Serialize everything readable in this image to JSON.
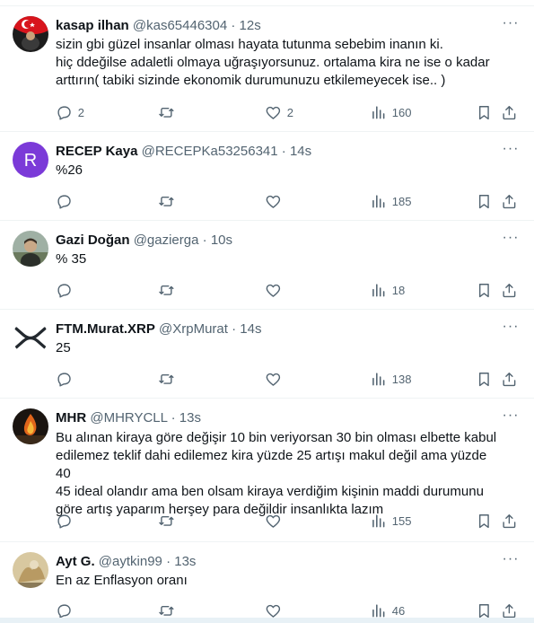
{
  "tweets": [
    {
      "name": "kasap ilhan",
      "handle": "@kas65446304",
      "time": "12s",
      "text": "sizin gbi güzel insanlar olması hayata tutunma sebebim inanın ki.\nhiç ddeğilse adaletli olmaya uğraşıyorsunuz. ortalama kira ne ise o kadar\narttırın( tabiki sizinde ekonomik durumunuzu etkilemeyecek ise.. )",
      "replies": "2",
      "retweets": "",
      "likes": "2",
      "views": "160",
      "avatar": "flag-avatar"
    },
    {
      "name": "RECEP Kaya",
      "handle": "@RECEPKa53256341",
      "time": "14s",
      "text": "%26",
      "replies": "",
      "retweets": "",
      "likes": "",
      "views": "185",
      "avatar": "letter-avatar",
      "avatar_letter": "R",
      "avatar_color": "#7b3ad8"
    },
    {
      "name": "Gazi Doğan",
      "handle": "@gazierga",
      "time": "10s",
      "text": "% 35",
      "replies": "",
      "retweets": "",
      "likes": "",
      "views": "18",
      "avatar": "photo-avatar"
    },
    {
      "name": "FTM.Murat.XRP",
      "handle": "@XrpMurat",
      "time": "14s",
      "text": "25",
      "replies": "",
      "retweets": "",
      "likes": "",
      "views": "138",
      "avatar": "xrp-logo-avatar"
    },
    {
      "name": "MHR",
      "handle": "@MHRYCLL",
      "time": "13s",
      "text": "Bu alınan kiraya göre değişir 10 bin veriyorsan 30 bin olması elbette kabul\nedilemez teklif dahi edilemez kira yüzde 25 artışı makul değil ama yüzde 40\n45 ideal olandır  ama ben olsam kiraya verdiğim kişinin maddi durumunu\ngöre artış yaparım herşey para değildir insanlıkta lazım",
      "replies": "",
      "retweets": "",
      "likes": "",
      "views": "155",
      "avatar": "fire-avatar"
    },
    {
      "name": "Ayt G.",
      "handle": "@aytkin99",
      "time": "13s",
      "text": "En az Enflasyon oranı",
      "replies": "",
      "retweets": "",
      "likes": "",
      "views": "46",
      "avatar": "photo-avatar-2"
    }
  ],
  "ui": {
    "separator_dot": "·",
    "more_glyph": "···"
  },
  "colors": {
    "text": "#0f1419",
    "secondary": "#536471",
    "divider": "#eff3f4"
  }
}
